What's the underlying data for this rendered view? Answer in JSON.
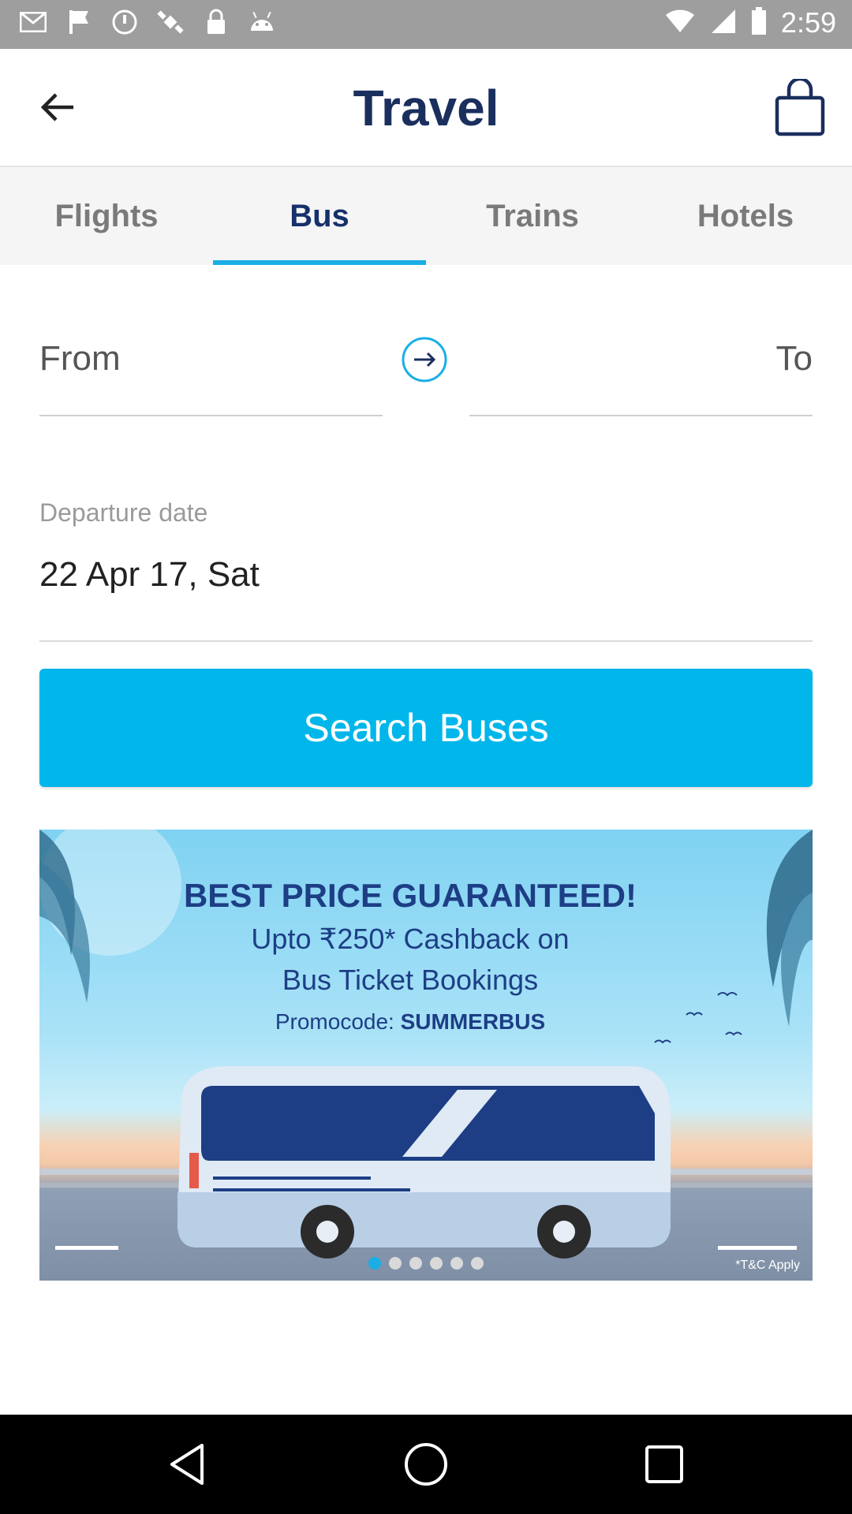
{
  "status_bar": {
    "time": "2:59",
    "left_icons": [
      "mail-icon",
      "flag-icon",
      "timer-icon",
      "satellite-icon",
      "lock-icon",
      "android-icon"
    ],
    "right_icons": [
      "wifi-icon",
      "signal-icon",
      "battery-icon"
    ]
  },
  "header": {
    "title": "Travel",
    "back_icon": "arrow-left-icon",
    "cart_icon": "shopping-bag-icon"
  },
  "tabs": [
    {
      "label": "Flights",
      "active": false
    },
    {
      "label": "Bus",
      "active": true
    },
    {
      "label": "Trains",
      "active": false
    },
    {
      "label": "Hotels",
      "active": false
    }
  ],
  "route": {
    "from_label": "From",
    "to_label": "To",
    "swap_icon": "arrow-right-circle-icon"
  },
  "departure": {
    "label": "Departure date",
    "value": "22 Apr 17, Sat"
  },
  "search_button": {
    "label": "Search Buses"
  },
  "banner": {
    "line1": "BEST PRICE GUARANTEED!",
    "line2": "Upto ₹250* Cashback on",
    "line3": "Bus Ticket Bookings",
    "promo_prefix": "Promocode: ",
    "promo_code": "SUMMERBUS",
    "terms": "*T&C Apply",
    "carousel_active_index": 0,
    "carousel_count": 6
  },
  "colors": {
    "accent": "#00b6ea",
    "title": "#1b2f5e",
    "tab_active": "#16306b",
    "tab_inactive": "#7a7a7a"
  },
  "nav_bar": {
    "buttons": [
      "back-triangle-icon",
      "home-circle-icon",
      "recents-square-icon"
    ]
  }
}
